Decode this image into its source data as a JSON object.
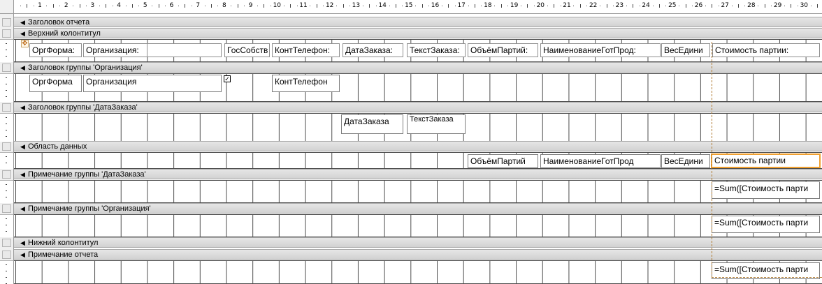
{
  "ruler": {
    "numbers": [
      "1",
      "2",
      "3",
      "4",
      "5",
      "6",
      "7",
      "8",
      "9",
      "10",
      "11",
      "12",
      "13",
      "14",
      "15",
      "16",
      "17",
      "18",
      "19",
      "20",
      "21",
      "22",
      "23",
      "24",
      "25",
      "26",
      "27",
      "28",
      "29",
      "30"
    ]
  },
  "bands": {
    "report_header": "Заголовок отчета",
    "page_header": "Верхний колонтитул",
    "group_header_org": "Заголовок группы 'Организация'",
    "group_header_date": "Заголовок группы 'ДатаЗаказа'",
    "detail": "Область данных",
    "group_footer_date": "Примечание группы 'ДатаЗаказа'",
    "group_footer_org": "Примечание группы 'Организация'",
    "page_footer": "Нижний колонтитул",
    "report_footer": "Примечание отчета"
  },
  "page_header": {
    "org_form_label": "ОргФорма:",
    "organization_label": "Организация:",
    "gos_label": "ГосСобств",
    "cont_phone_label": "КонтТелефон:",
    "order_date_label": "ДатаЗаказа:",
    "order_text_label": "ТекстЗаказа:",
    "batch_volume_label": "ОбъёмПартий:",
    "product_name_label": "НаименованиеГотПрод:",
    "unit_weight_label": "ВесЕдини",
    "batch_cost_label": "Стоимость партии:"
  },
  "group_header_org": {
    "org_form_field": "ОргФорма",
    "organization_field": "Организация",
    "gos_checkbox": "✓",
    "cont_phone_field": "КонтТелефон"
  },
  "group_header_date": {
    "order_date_field": "ДатаЗаказа",
    "order_text_field": "ТекстЗаказа"
  },
  "detail": {
    "batch_volume_field": "ОбъёмПартий",
    "product_name_field": "НаименованиеГотПрод",
    "unit_weight_field": "ВесЕдини",
    "batch_cost_field": "Стоимость партии"
  },
  "group_footer_date": {
    "sum_field": "=Sum([Стоимость парти"
  },
  "group_footer_org": {
    "sum_field": "=Sum([Стоимость парти"
  },
  "report_footer": {
    "sum_field": "=Sum([Стоимость парти"
  },
  "colors": {
    "band_bg": "#dcdcdc",
    "grid_line": "#4c4c4c",
    "selection": "#f0a030"
  }
}
